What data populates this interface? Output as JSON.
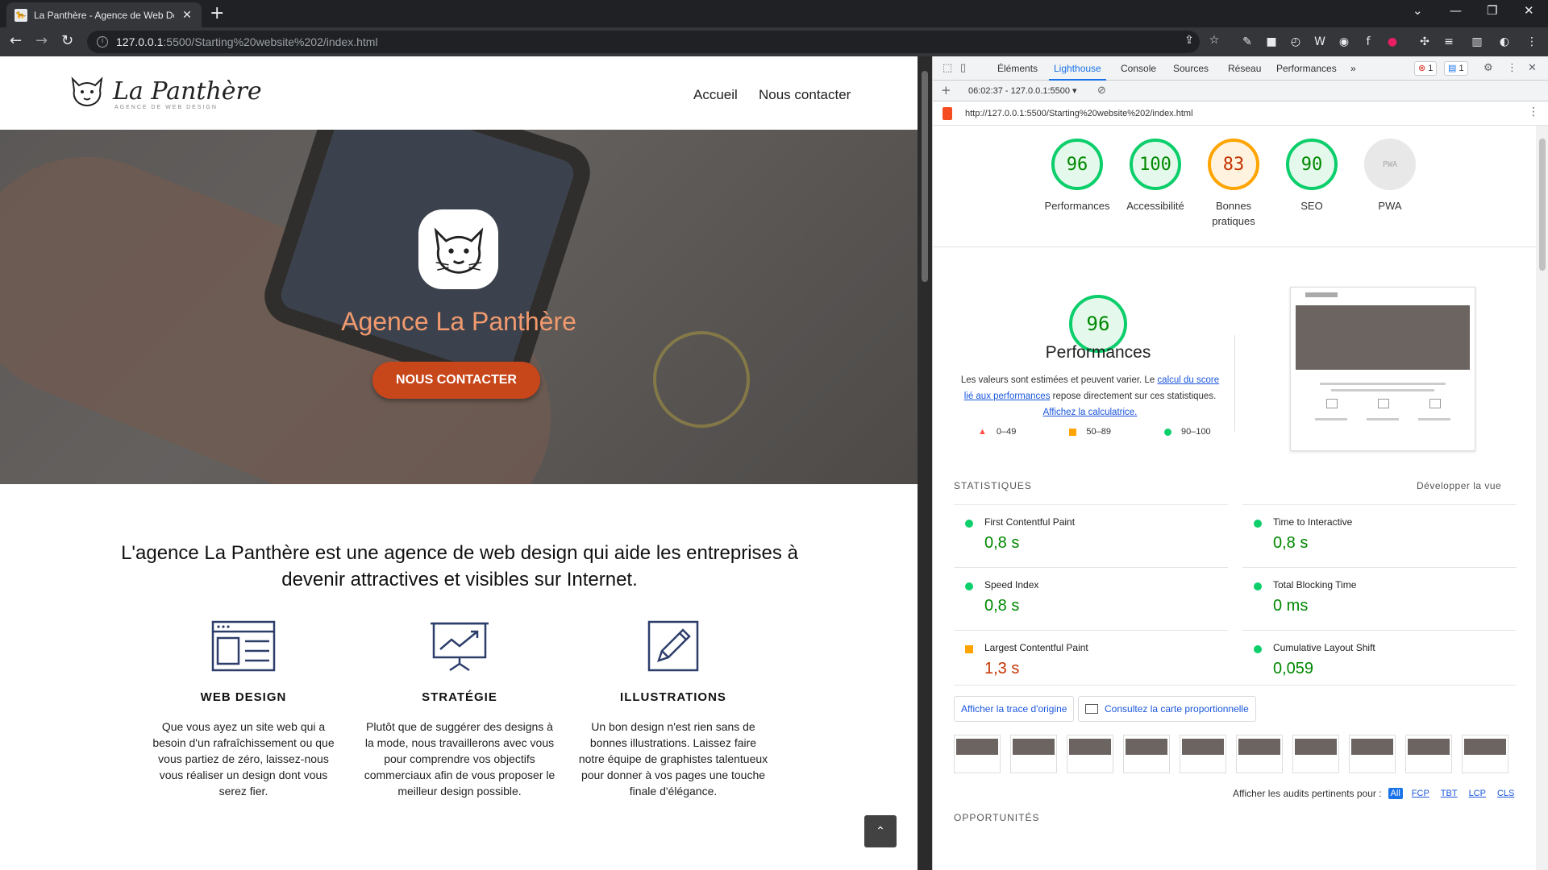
{
  "browser": {
    "tab_title": "La Panthère - Agence de Web De",
    "tab_close": "✕",
    "new_tab": "+",
    "url_host": "127.0.0.1",
    "url_path": ":5500/Starting%20website%202/index.html"
  },
  "site": {
    "logo_name": "La Panthère",
    "logo_tagline": "AGENCE DE WEB DESIGN",
    "nav": [
      "Accueil",
      "Nous contacter"
    ],
    "hero_title": "Agence La Panthère",
    "hero_button": "NOUS CONTACTER",
    "intro": "L'agence La Panthère est une agence de web design qui aide les entreprises à devenir attractives et visibles sur Internet.",
    "services": [
      {
        "title": "WEB DESIGN",
        "text": "Que vous ayez un site web qui a besoin d'un rafraîchissement ou que vous partiez de zéro, laissez-nous vous réaliser un design dont vous serez fier."
      },
      {
        "title": "STRATÉGIE",
        "text": "Plutôt que de suggérer des designs à la mode, nous travaillerons avec vous pour comprendre vos objectifs commerciaux afin de vous proposer le meilleur design possible."
      },
      {
        "title": "ILLUSTRATIONS",
        "text": "Un bon design n'est rien sans de bonnes illustrations. Laissez faire notre équipe de graphistes talentueux pour donner à vos pages une touche finale d'élégance."
      }
    ],
    "back_to_top": "⌃"
  },
  "devtools": {
    "tabs": [
      "Éléments",
      "Lighthouse",
      "Console",
      "Sources",
      "Réseau",
      "Performances"
    ],
    "more": "»",
    "errors_badge": "1",
    "messages_badge": "1",
    "report_selector": "06:02:37 - 127.0.0.1:5500",
    "report_url": "http://127.0.0.1:5500/Starting%20website%202/index.html"
  },
  "lighthouse": {
    "scores": [
      {
        "value": "96",
        "label": "Performances",
        "status": "green"
      },
      {
        "value": "100",
        "label": "Accessibilité",
        "status": "green"
      },
      {
        "value": "83",
        "label": "Bonnes pratiques",
        "status": "orange"
      },
      {
        "value": "90",
        "label": "SEO",
        "status": "green"
      },
      {
        "value": "PWA",
        "label": "PWA",
        "status": "gray"
      }
    ],
    "perf_score": "96",
    "perf_title": "Performances",
    "perf_desc_1": "Les valeurs sont estimées et peuvent varier. Le ",
    "perf_link_1": "calcul du score lié aux performances",
    "perf_desc_2": " repose directement sur ces statistiques. ",
    "perf_link_2": "Affichez la calculatrice.",
    "legend": [
      "0–49",
      "50–89",
      "90–100"
    ],
    "stats_title": "STATISTIQUES",
    "stats_expand": "Développer la vue",
    "metrics": [
      {
        "name": "First Contentful Paint",
        "value": "0,8 s",
        "status": "green"
      },
      {
        "name": "Time to Interactive",
        "value": "0,8 s",
        "status": "green"
      },
      {
        "name": "Speed Index",
        "value": "0,8 s",
        "status": "green"
      },
      {
        "name": "Total Blocking Time",
        "value": "0 ms",
        "status": "green"
      },
      {
        "name": "Largest Contentful Paint",
        "value": "1,3 s",
        "status": "orange"
      },
      {
        "name": "Cumulative Layout Shift",
        "value": "0,059",
        "status": "green"
      }
    ],
    "trace_button": "Afficher la trace d'origine",
    "treemap_button": "Consultez la carte proportionnelle",
    "filter_label": "Afficher les audits pertinents pour :",
    "filters": [
      "All",
      "FCP",
      "TBT",
      "LCP",
      "CLS"
    ],
    "opportunities": "OPPORTUNITÉS"
  },
  "colors": {
    "pass": "#0cce6b",
    "average": "#ffa400",
    "fail": "#ff4e42",
    "accent": "#c7461a"
  }
}
